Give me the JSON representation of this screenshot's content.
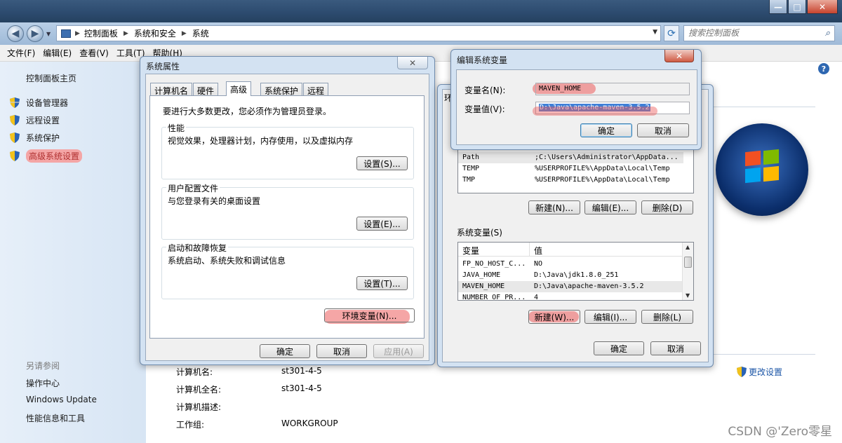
{
  "address": {
    "crumbs": [
      "控制面板",
      "系统和安全",
      "系统"
    ],
    "search_placeholder": "搜索控制面板"
  },
  "menu": [
    "文件(F)",
    "编辑(E)",
    "查看(V)",
    "工具(T)",
    "帮助(H)"
  ],
  "sidebar": {
    "home": "控制面板主页",
    "items": [
      "设备管理器",
      "远程设置",
      "系统保护",
      "高级系统设置"
    ],
    "see_also_title": "另请参阅",
    "see_also": [
      "操作中心",
      "Windows Update",
      "性能信息和工具"
    ]
  },
  "computer_info": {
    "rows": [
      {
        "label": "计算机名:",
        "value": "st301-4-5"
      },
      {
        "label": "计算机全名:",
        "value": "st301-4-5"
      },
      {
        "label": "计算机描述:",
        "value": ""
      },
      {
        "label": "工作组:",
        "value": "WORKGROUP"
      }
    ],
    "change_settings": "更改设置"
  },
  "sys_props": {
    "title": "系统属性",
    "tabs": [
      "计算机名",
      "硬件",
      "高级",
      "系统保护",
      "远程"
    ],
    "admin_note": "要进行大多数更改，您必须作为管理员登录。",
    "groups": [
      {
        "title": "性能",
        "desc": "视觉效果，处理器计划，内存使用，以及虚拟内存",
        "button": "设置(S)..."
      },
      {
        "title": "用户配置文件",
        "desc": "与您登录有关的桌面设置",
        "button": "设置(E)..."
      },
      {
        "title": "启动和故障恢复",
        "desc": "系统启动、系统失败和调试信息",
        "button": "设置(T)..."
      }
    ],
    "env_button": "环境变量(N)...",
    "ok": "确定",
    "cancel": "取消",
    "apply": "应用(A)"
  },
  "env_vars": {
    "title_partial": "环",
    "user_rows": [
      {
        "name": "Path",
        "value": ";C:\\Users\\Administrator\\AppData..."
      },
      {
        "name": "TEMP",
        "value": "%USERPROFILE%\\AppData\\Local\\Temp"
      },
      {
        "name": "TMP",
        "value": "%USERPROFILE%\\AppData\\Local\\Temp"
      }
    ],
    "user_buttons": [
      "新建(N)...",
      "编辑(E)...",
      "删除(D)"
    ],
    "system_title": "系统变量(S)",
    "col_var": "变量",
    "col_val": "值",
    "system_rows": [
      {
        "name": "FP_NO_HOST_C...",
        "value": "NO"
      },
      {
        "name": "JAVA_HOME",
        "value": "D:\\Java\\jdk1.8.0_251"
      },
      {
        "name": "MAVEN_HOME",
        "value": "D:\\Java\\apache-maven-3.5.2"
      },
      {
        "name": "NUMBER_OF_PR...",
        "value": "4"
      }
    ],
    "system_buttons": [
      "新建(W)...",
      "编辑(I)...",
      "删除(L)"
    ],
    "ok": "确定",
    "cancel": "取消"
  },
  "edit_var": {
    "title": "编辑系统变量",
    "name_label": "变量名(N):",
    "name_value": "MAVEN_HOME",
    "value_label": "变量值(V):",
    "value_value": "D:\\Java\\apache-maven-3.5.2",
    "ok": "确定",
    "cancel": "取消"
  },
  "watermark": "CSDN @'Zero零星"
}
